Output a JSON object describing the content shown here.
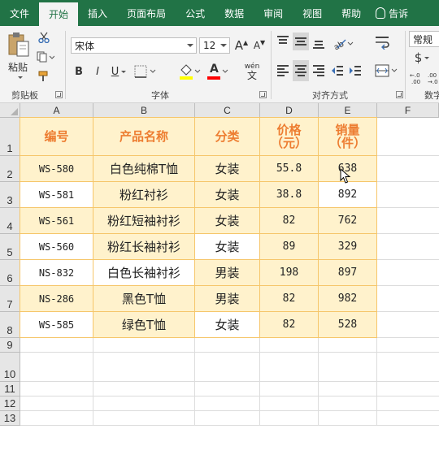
{
  "ribbon_tabs": [
    "文件",
    "开始",
    "插入",
    "页面布局",
    "公式",
    "数据",
    "审阅",
    "视图",
    "帮助"
  ],
  "active_tab": "开始",
  "tell_me": "告诉",
  "clipboard": {
    "paste_label": "粘贴",
    "group_label": "剪贴板"
  },
  "font": {
    "name": "宋体",
    "size": "12",
    "group_label": "字体",
    "bold": "B",
    "italic": "I",
    "underline": "U",
    "grow": "A",
    "shrink": "A",
    "font_color_letter": "A",
    "phonetic_top": "wén",
    "phonetic_bottom": "文"
  },
  "alignment": {
    "group_label": "对齐方式"
  },
  "number": {
    "format": "常规",
    "currency_symbol": "$",
    "group_label": "数字",
    "inc_decimal": "←.0\n.00",
    "dec_decimal": ".00\n→.0"
  },
  "colors": {
    "ribbon_green": "#217346",
    "header_fill": "#fff2cc",
    "header_text": "#ed7d31",
    "border": "#f6c66a",
    "font_color_bar": "#ff0000",
    "fill_color_bar": "#ffff00"
  },
  "columns": [
    "A",
    "B",
    "C",
    "D",
    "E",
    "F"
  ],
  "rows": [
    "1",
    "2",
    "3",
    "4",
    "5",
    "6",
    "7",
    "8",
    "9",
    "10",
    "11",
    "12",
    "13"
  ],
  "table": {
    "headers": [
      "编号",
      "产品名称",
      "分类",
      "价格\n（元）",
      "销量\n（件）"
    ],
    "rows": [
      [
        "WS-580",
        "白色纯棉T恤",
        "女装",
        "55.8",
        "638"
      ],
      [
        "WS-581",
        "粉红衬衫",
        "女装",
        "38.8",
        "892"
      ],
      [
        "WS-561",
        "粉红短袖衬衫",
        "女装",
        "82",
        "762"
      ],
      [
        "WS-560",
        "粉红长袖衬衫",
        "女装",
        "89",
        "329"
      ],
      [
        "NS-832",
        "白色长袖衬衫",
        "男装",
        "198",
        "897"
      ],
      [
        "NS-286",
        "黑色T恤",
        "男装",
        "82",
        "982"
      ],
      [
        "WS-585",
        "绿色T恤",
        "女装",
        "82",
        "528"
      ]
    ],
    "white_cells": [
      "1-0",
      "1-4",
      "3-0",
      "3-2",
      "4-0",
      "4-1",
      "6-0",
      "6-2"
    ]
  }
}
